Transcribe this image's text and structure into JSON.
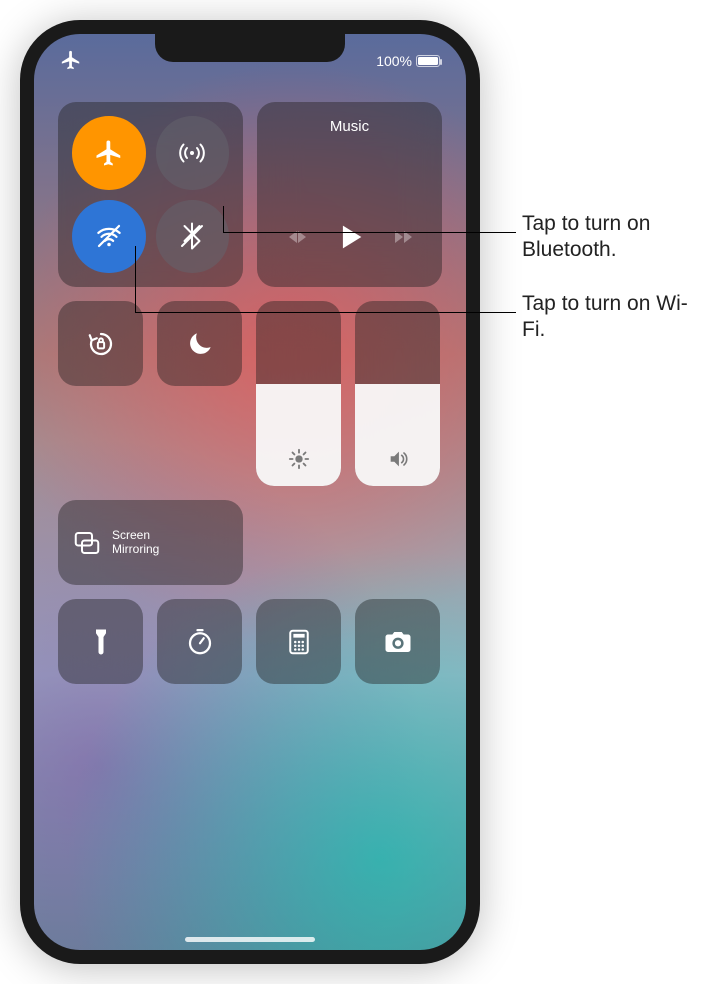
{
  "statusbar": {
    "battery_label": "100%",
    "airplane_on": true
  },
  "music": {
    "title": "Music"
  },
  "screen_mirroring": {
    "label_line1": "Screen",
    "label_line2": "Mirroring"
  },
  "sliders": {
    "brightness_pct": 55,
    "volume_pct": 55
  },
  "connectivity": {
    "airplane_on": true,
    "cellular_on": false,
    "wifi_on": false,
    "bluetooth_on": false
  },
  "callouts": {
    "bluetooth": "Tap to turn on Bluetooth.",
    "wifi": "Tap to turn on Wi-Fi."
  },
  "icons": {
    "airplane": "airplane-icon",
    "cellular": "cellular-icon",
    "wifi_off": "wifi-off-icon",
    "bluetooth_off": "bluetooth-off-icon",
    "rotation_lock": "rotation-lock-icon",
    "dnd": "do-not-disturb-icon",
    "screen_mirroring": "screen-mirroring-icon",
    "brightness": "brightness-icon",
    "volume": "volume-icon",
    "flashlight": "flashlight-icon",
    "timer": "timer-icon",
    "calculator": "calculator-icon",
    "camera": "camera-icon",
    "play": "play-icon",
    "prev": "previous-track-icon",
    "next": "next-track-icon",
    "battery": "battery-icon"
  }
}
